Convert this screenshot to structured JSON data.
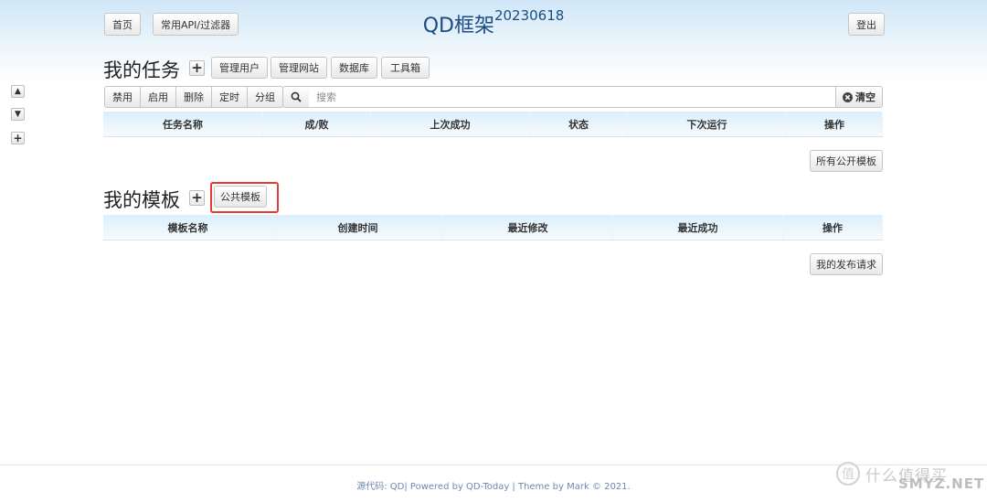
{
  "header": {
    "home_label": "首页",
    "api_label": "常用API/过滤器",
    "title_main": "QD框架",
    "title_version": "20230618",
    "logout_label": "登出"
  },
  "tasks": {
    "title": "我的任务",
    "plus_label": "+",
    "nav": [
      "管理用户",
      "管理网站",
      "数据库",
      "工具箱"
    ],
    "actions": [
      "禁用",
      "启用",
      "删除",
      "定时",
      "分组"
    ],
    "search_placeholder": "搜索",
    "clear_label": "清空",
    "columns": [
      "任务名称",
      "成/败",
      "上次成功",
      "状态",
      "下次运行",
      "操作"
    ],
    "all_public_label": "所有公开模板"
  },
  "templates": {
    "title": "我的模板",
    "plus_label": "+",
    "public_label": "公共模板",
    "columns": [
      "模板名称",
      "创建时间",
      "最近修改",
      "最近成功",
      "操作"
    ],
    "publish_label": "我的发布请求"
  },
  "side": {
    "up": "▲",
    "down": "▼",
    "add": "+"
  },
  "footer": {
    "text": "源代码: QD| Powered by QD-Today | Theme by Mark © 2021."
  },
  "watermark": {
    "glyph": "值",
    "text": "什么值得买",
    "overlay": "SMYZ.NET"
  },
  "colors": {
    "title": "#1c4c85",
    "highlight": "#e53935",
    "footer": "#6e89b0"
  }
}
